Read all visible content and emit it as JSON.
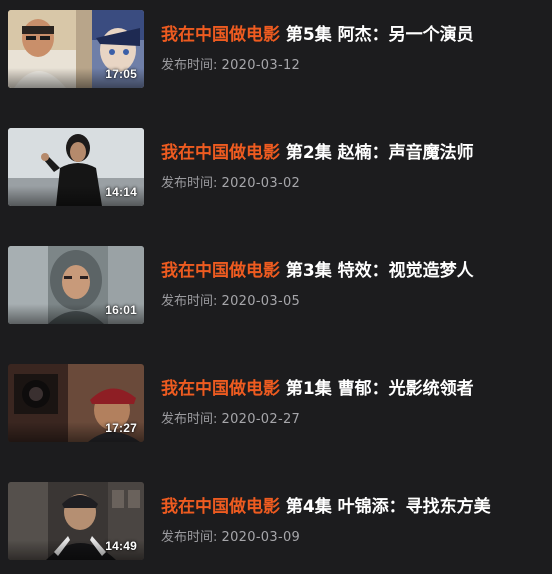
{
  "videos": [
    {
      "series": "我在中国做电影",
      "episode": " 第5集 阿杰：另一个演员",
      "date_label": "发布时间:",
      "date": "2020-03-12",
      "duration": "17:05"
    },
    {
      "series": "我在中国做电影",
      "episode": " 第2集 赵楠：声音魔法师",
      "date_label": "发布时间:",
      "date": "2020-03-02",
      "duration": "14:14"
    },
    {
      "series": "我在中国做电影",
      "episode": " 第3集 特效：视觉造梦人",
      "date_label": "发布时间:",
      "date": "2020-03-05",
      "duration": "16:01"
    },
    {
      "series": "我在中国做电影",
      "episode": " 第1集 曹郁：光影统领者",
      "date_label": "发布时间:",
      "date": "2020-02-27",
      "duration": "17:27"
    },
    {
      "series": "我在中国做电影",
      "episode": " 第4集 叶锦添：寻找东方美",
      "date_label": "发布时间:",
      "date": "2020-03-09",
      "duration": "14:49"
    }
  ],
  "colors": {
    "background": "#1c1c1e",
    "series_accent": "#ee5b20",
    "episode_text": "#ffffff",
    "meta_text": "#9a9a9e"
  }
}
